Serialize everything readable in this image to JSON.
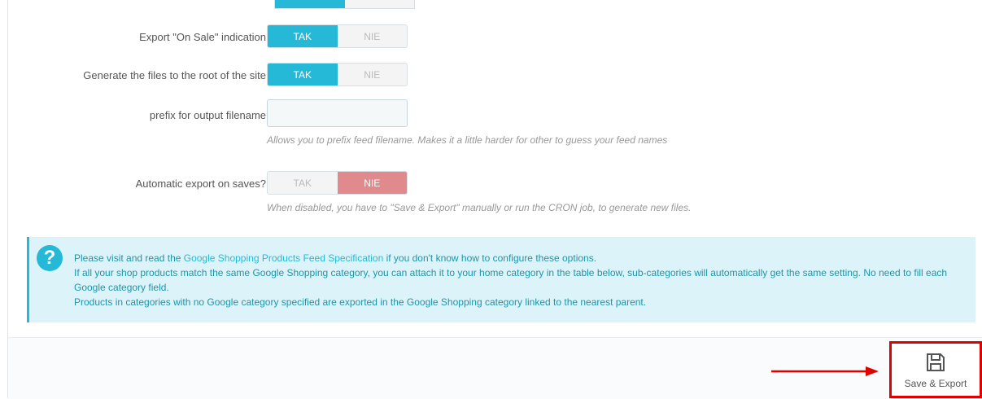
{
  "form": {
    "on_sale": {
      "label": "Export \"On Sale\" indication",
      "yes": "TAK",
      "no": "NIE",
      "selected": "TAK"
    },
    "root_files": {
      "label": "Generate the files to the root of the site",
      "yes": "TAK",
      "no": "NIE",
      "selected": "TAK"
    },
    "prefix": {
      "label": "prefix for output filename",
      "value": "",
      "help": "Allows you to prefix feed filename. Makes it a little harder for other to guess your feed names"
    },
    "auto_export": {
      "label": "Automatic export on saves?",
      "yes": "TAK",
      "no": "NIE",
      "selected": "NIE",
      "help": "When disabled, you have to \"Save & Export\" manually or run the CRON job, to generate new files."
    }
  },
  "info": {
    "line1_pre": "Please visit and read the ",
    "line1_link": "Google Shopping Products Feed Specification",
    "line1_post": " if you don't know how to configure these options.",
    "line2": "If all your shop products match the same Google Shopping category, you can attach it to your home category in the table below, sub-categories will automatically get the same setting. No need to fill each Google category field.",
    "line3": "Products in categories with no Google category specified are exported in the Google Shopping category linked to the nearest parent.",
    "icon_symbol": "?"
  },
  "footer": {
    "save_export_label": "Save & Export"
  },
  "colors": {
    "accent": "#25b9d7",
    "danger": "#e08a8e",
    "highlight": "#e10000"
  }
}
